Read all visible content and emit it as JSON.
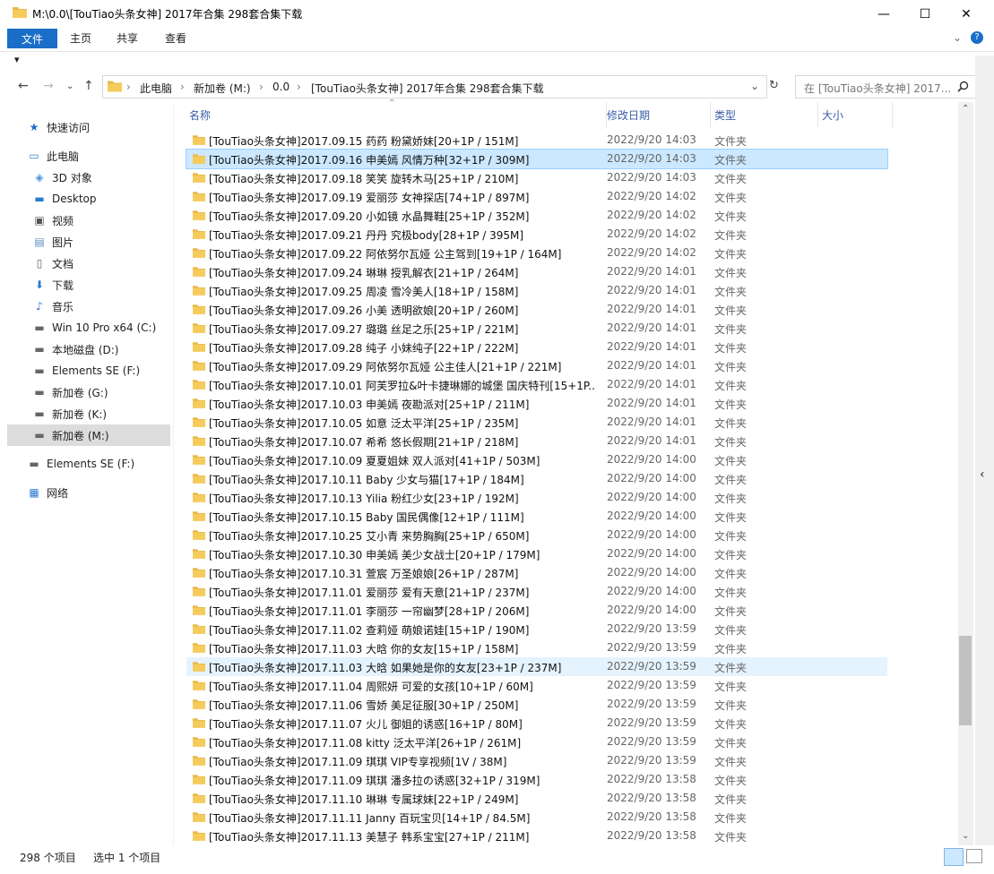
{
  "window": {
    "title": "M:\\0.0\\[TouTiao头条女神] 2017年合集 298套合集下载",
    "minimize": "—",
    "maximize": "☐",
    "close": "✕"
  },
  "ribbon": {
    "tabs": [
      "文件",
      "主页",
      "共享",
      "查看"
    ],
    "qat": "▾"
  },
  "address": {
    "crumbs": [
      "此电脑",
      "新加卷 (M:)",
      "0.0",
      "[TouTiao头条女神] 2017年合集 298套合集下载"
    ],
    "search_placeholder": "在 [TouTiao头条女神] 2017...",
    "sep": "›"
  },
  "sidebar": {
    "items": [
      {
        "label": "快速访问",
        "icon": "star-icon"
      },
      {
        "label": "此电脑",
        "icon": "computer-icon"
      },
      {
        "label": "3D 对象",
        "icon": "3d-icon"
      },
      {
        "label": "Desktop",
        "icon": "desktop-icon"
      },
      {
        "label": "视频",
        "icon": "video-icon"
      },
      {
        "label": "图片",
        "icon": "picture-icon"
      },
      {
        "label": "文档",
        "icon": "document-icon"
      },
      {
        "label": "下载",
        "icon": "download-icon"
      },
      {
        "label": "音乐",
        "icon": "music-icon"
      },
      {
        "label": "Win 10 Pro x64 (C:)",
        "icon": "drive-icon"
      },
      {
        "label": "本地磁盘 (D:)",
        "icon": "drive-icon"
      },
      {
        "label": "Elements SE (F:)",
        "icon": "drive-icon"
      },
      {
        "label": "新加卷 (G:)",
        "icon": "drive-icon"
      },
      {
        "label": "新加卷 (K:)",
        "icon": "drive-icon"
      },
      {
        "label": "新加卷 (M:)",
        "icon": "drive-icon"
      },
      {
        "label": "Elements SE (F:)",
        "icon": "drive-icon"
      },
      {
        "label": "网络",
        "icon": "network-icon"
      }
    ]
  },
  "columns": {
    "name": "名称",
    "date": "修改日期",
    "type": "类型",
    "size": "大小"
  },
  "files": [
    {
      "name": "[TouTiao头条女神]2017.09.15 药药 粉黛娇妹[20+1P / 151M]",
      "date": "2022/9/20 14:03",
      "type": "文件夹"
    },
    {
      "name": "[TouTiao头条女神]2017.09.16 申美嫣 风情万种[32+1P / 309M]",
      "date": "2022/9/20 14:03",
      "type": "文件夹"
    },
    {
      "name": "[TouTiao头条女神]2017.09.18 笑笑 旋转木马[25+1P / 210M]",
      "date": "2022/9/20 14:03",
      "type": "文件夹"
    },
    {
      "name": "[TouTiao头条女神]2017.09.19 爱丽莎 女神探店[74+1P / 897M]",
      "date": "2022/9/20 14:02",
      "type": "文件夹"
    },
    {
      "name": "[TouTiao头条女神]2017.09.20 小如镜 水晶舞鞋[25+1P / 352M]",
      "date": "2022/9/20 14:02",
      "type": "文件夹"
    },
    {
      "name": "[TouTiao头条女神]2017.09.21 丹丹 究极body[28+1P / 395M]",
      "date": "2022/9/20 14:02",
      "type": "文件夹"
    },
    {
      "name": "[TouTiao头条女神]2017.09.22 阿依努尔瓦娅 公主驾到[19+1P / 164M]",
      "date": "2022/9/20 14:02",
      "type": "文件夹"
    },
    {
      "name": "[TouTiao头条女神]2017.09.24 琳琳 授乳解衣[21+1P / 264M]",
      "date": "2022/9/20 14:01",
      "type": "文件夹"
    },
    {
      "name": "[TouTiao头条女神]2017.09.25 周凌 雪冷美人[18+1P / 158M]",
      "date": "2022/9/20 14:01",
      "type": "文件夹"
    },
    {
      "name": "[TouTiao头条女神]2017.09.26 小美 透明欲娘[20+1P / 260M]",
      "date": "2022/9/20 14:01",
      "type": "文件夹"
    },
    {
      "name": "[TouTiao头条女神]2017.09.27 璐璐 丝足之乐[25+1P / 221M]",
      "date": "2022/9/20 14:01",
      "type": "文件夹"
    },
    {
      "name": "[TouTiao头条女神]2017.09.28 纯子 小妹纯子[22+1P / 222M]",
      "date": "2022/9/20 14:01",
      "type": "文件夹"
    },
    {
      "name": "[TouTiao头条女神]2017.09.29 阿依努尔瓦娅 公主佳人[21+1P / 221M]",
      "date": "2022/9/20 14:01",
      "type": "文件夹"
    },
    {
      "name": "[TouTiao头条女神]2017.10.01 阿芙罗拉&叶卡捷琳娜的城堡 国庆特刊[15+1P...",
      "date": "2022/9/20 14:01",
      "type": "文件夹"
    },
    {
      "name": "[TouTiao头条女神]2017.10.03 申美嫣 夜勘派对[25+1P / 211M]",
      "date": "2022/9/20 14:01",
      "type": "文件夹"
    },
    {
      "name": "[TouTiao头条女神]2017.10.05 如意 泛太平洋[25+1P / 235M]",
      "date": "2022/9/20 14:01",
      "type": "文件夹"
    },
    {
      "name": "[TouTiao头条女神]2017.10.07 希希 悠长假期[21+1P / 218M]",
      "date": "2022/9/20 14:01",
      "type": "文件夹"
    },
    {
      "name": "[TouTiao头条女神]2017.10.09 夏夏姐妹 双人派对[41+1P / 503M]",
      "date": "2022/9/20 14:00",
      "type": "文件夹"
    },
    {
      "name": "[TouTiao头条女神]2017.10.11 Baby 少女与猫[17+1P / 184M]",
      "date": "2022/9/20 14:00",
      "type": "文件夹"
    },
    {
      "name": "[TouTiao头条女神]2017.10.13 Yilia 粉红少女[23+1P / 192M]",
      "date": "2022/9/20 14:00",
      "type": "文件夹"
    },
    {
      "name": "[TouTiao头条女神]2017.10.15 Baby 国民偶像[12+1P / 111M]",
      "date": "2022/9/20 14:00",
      "type": "文件夹"
    },
    {
      "name": "[TouTiao头条女神]2017.10.25 艾小青 来势胸胸[25+1P / 650M]",
      "date": "2022/9/20 14:00",
      "type": "文件夹"
    },
    {
      "name": "[TouTiao头条女神]2017.10.30 申美嫣 美少女战士[20+1P / 179M]",
      "date": "2022/9/20 14:00",
      "type": "文件夹"
    },
    {
      "name": "[TouTiao头条女神]2017.10.31 萱宸 万圣娘娘[26+1P / 287M]",
      "date": "2022/9/20 14:00",
      "type": "文件夹"
    },
    {
      "name": "[TouTiao头条女神]2017.11.01 爱丽莎 爱有天意[21+1P / 237M]",
      "date": "2022/9/20 14:00",
      "type": "文件夹"
    },
    {
      "name": "[TouTiao头条女神]2017.11.01 李丽莎 一帘幽梦[28+1P / 206M]",
      "date": "2022/9/20 14:00",
      "type": "文件夹"
    },
    {
      "name": "[TouTiao头条女神]2017.11.02 查莉娅 萌娘诺娃[15+1P / 190M]",
      "date": "2022/9/20 13:59",
      "type": "文件夹"
    },
    {
      "name": "[TouTiao头条女神]2017.11.03 大晗 你的女友[15+1P / 158M]",
      "date": "2022/9/20 13:59",
      "type": "文件夹"
    },
    {
      "name": "[TouTiao头条女神]2017.11.03 大晗 如果她是你的女友[23+1P / 237M]",
      "date": "2022/9/20 13:59",
      "type": "文件夹"
    },
    {
      "name": "[TouTiao头条女神]2017.11.04 周熙妍 可爱的女孩[10+1P / 60M]",
      "date": "2022/9/20 13:59",
      "type": "文件夹"
    },
    {
      "name": "[TouTiao头条女神]2017.11.06 雪娇 美足征服[30+1P / 250M]",
      "date": "2022/9/20 13:59",
      "type": "文件夹"
    },
    {
      "name": "[TouTiao头条女神]2017.11.07 火儿 御姐的诱惑[16+1P / 80M]",
      "date": "2022/9/20 13:59",
      "type": "文件夹"
    },
    {
      "name": "[TouTiao头条女神]2017.11.08 kitty 泛太平洋[26+1P / 261M]",
      "date": "2022/9/20 13:59",
      "type": "文件夹"
    },
    {
      "name": "[TouTiao头条女神]2017.11.09 琪琪 VIP专享视频[1V / 38M]",
      "date": "2022/9/20 13:59",
      "type": "文件夹"
    },
    {
      "name": "[TouTiao头条女神]2017.11.09 琪琪 潘多拉の诱惑[32+1P / 319M]",
      "date": "2022/9/20 13:58",
      "type": "文件夹"
    },
    {
      "name": "[TouTiao头条女神]2017.11.10 琳琳 专属球妹[22+1P / 249M]",
      "date": "2022/9/20 13:58",
      "type": "文件夹"
    },
    {
      "name": "[TouTiao头条女神]2017.11.11 Janny 百玩宝贝[14+1P / 84.5M]",
      "date": "2022/9/20 13:58",
      "type": "文件夹"
    },
    {
      "name": "[TouTiao头条女神]2017.11.13 美慧子 韩系宝宝[27+1P / 211M]",
      "date": "2022/9/20 13:58",
      "type": "文件夹"
    }
  ],
  "selected_index": 1,
  "hover_index": 28,
  "status": {
    "count": "298 个项目",
    "selected": "选中 1 个项目"
  },
  "colors": {
    "accent": "#1a6ec8",
    "folder": "#e8b84a",
    "selected": "#cce8ff"
  }
}
